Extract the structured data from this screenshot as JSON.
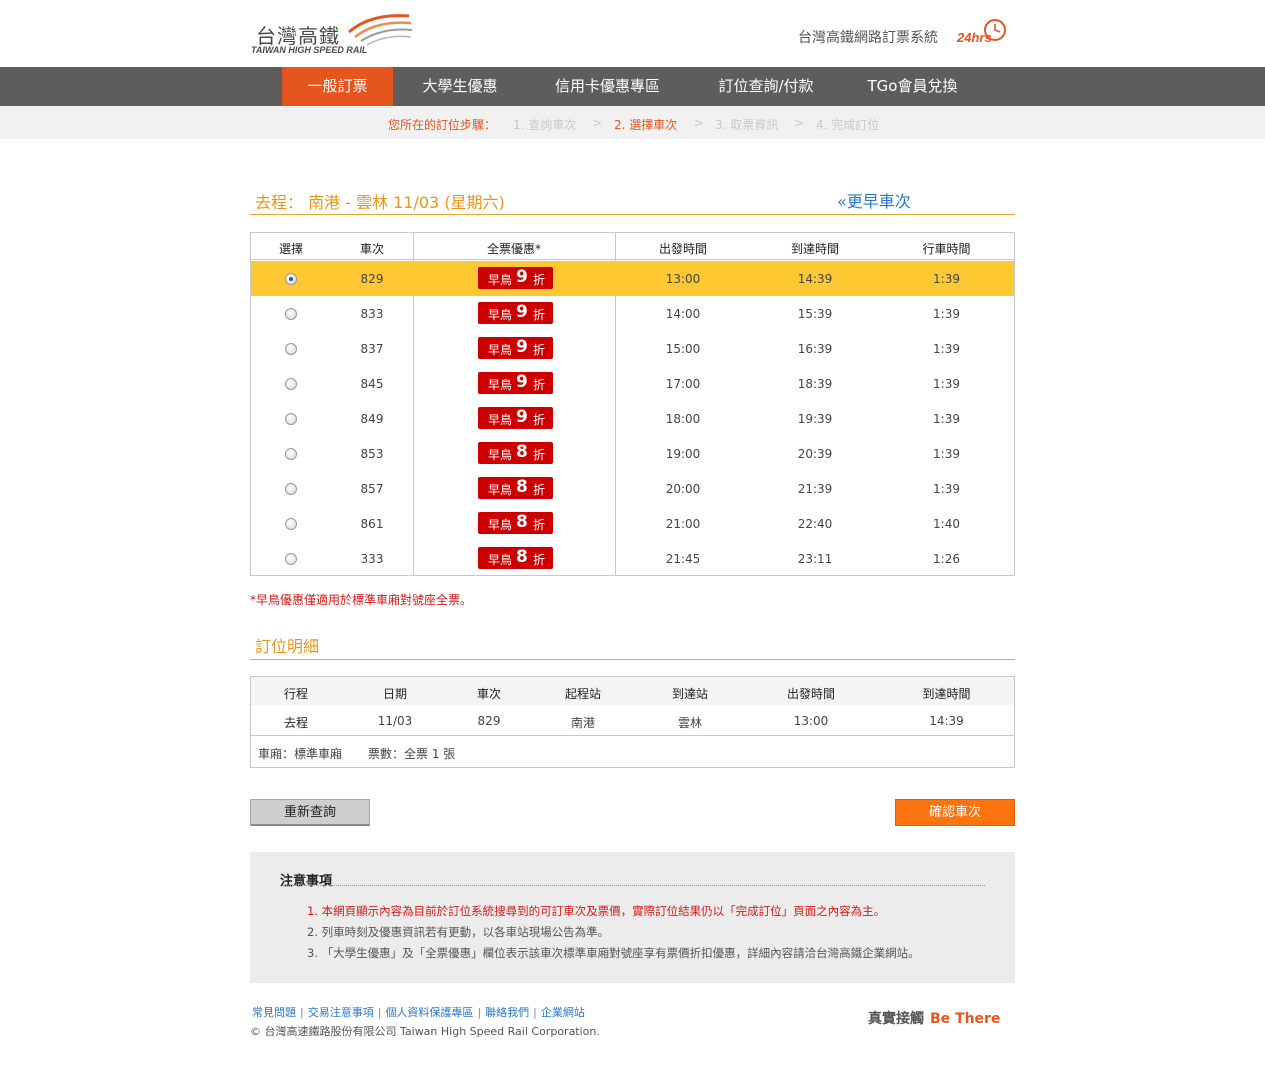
{
  "header": {
    "logo_zh": "台灣高鐵",
    "logo_en": "TAIWAN HIGH SPEED RAIL",
    "system_title": "台灣高鐵網路訂票系統",
    "system_24": "24hrs"
  },
  "nav": {
    "items": [
      {
        "label": "一般訂票",
        "active": true
      },
      {
        "label": "大學生優惠",
        "active": false
      },
      {
        "label": "信用卡優惠專區",
        "active": false
      },
      {
        "label": "訂位查詢/付款",
        "active": false
      },
      {
        "label": "TGo會員兌換",
        "active": false
      }
    ]
  },
  "steps": {
    "label": "您所在的訂位步驟：",
    "items": [
      "1. 查詢車次",
      "2. 選擇車次",
      "3. 取票資訊",
      "4. 完成訂位"
    ],
    "separator": ">",
    "current": 1
  },
  "trip": {
    "title": "去程： 南港 - 雲林 11/03 (星期六)",
    "earlier_link": "«更早車次"
  },
  "trains_table": {
    "headers": [
      "選擇",
      "車次",
      "全票優惠*",
      "出發時間",
      "到達時間",
      "行車時間"
    ],
    "rows": [
      {
        "train": "829",
        "discount_prefix": "早鳥",
        "discount": "9",
        "discount_suffix": "折",
        "depart": "13:00",
        "arrive": "14:39",
        "duration": "1:39",
        "selected": true
      },
      {
        "train": "833",
        "discount_prefix": "早鳥",
        "discount": "9",
        "discount_suffix": "折",
        "depart": "14:00",
        "arrive": "15:39",
        "duration": "1:39",
        "selected": false
      },
      {
        "train": "837",
        "discount_prefix": "早鳥",
        "discount": "9",
        "discount_suffix": "折",
        "depart": "15:00",
        "arrive": "16:39",
        "duration": "1:39",
        "selected": false
      },
      {
        "train": "845",
        "discount_prefix": "早鳥",
        "discount": "9",
        "discount_suffix": "折",
        "depart": "17:00",
        "arrive": "18:39",
        "duration": "1:39",
        "selected": false
      },
      {
        "train": "849",
        "discount_prefix": "早鳥",
        "discount": "9",
        "discount_suffix": "折",
        "depart": "18:00",
        "arrive": "19:39",
        "duration": "1:39",
        "selected": false
      },
      {
        "train": "853",
        "discount_prefix": "早鳥",
        "discount": "8",
        "discount_suffix": "折",
        "depart": "19:00",
        "arrive": "20:39",
        "duration": "1:39",
        "selected": false
      },
      {
        "train": "857",
        "discount_prefix": "早鳥",
        "discount": "8",
        "discount_suffix": "折",
        "depart": "20:00",
        "arrive": "21:39",
        "duration": "1:39",
        "selected": false
      },
      {
        "train": "861",
        "discount_prefix": "早鳥",
        "discount": "8",
        "discount_suffix": "折",
        "depart": "21:00",
        "arrive": "22:40",
        "duration": "1:40",
        "selected": false
      },
      {
        "train": "333",
        "discount_prefix": "早鳥",
        "discount": "8",
        "discount_suffix": "折",
        "depart": "21:45",
        "arrive": "23:11",
        "duration": "1:26",
        "selected": false
      }
    ],
    "footnote": "*早鳥優惠僅適用於標準車廂對號座全票。"
  },
  "booking": {
    "title": "訂位明細",
    "headers": [
      "行程",
      "日期",
      "車次",
      "起程站",
      "到達站",
      "出發時間",
      "到達時間"
    ],
    "row": [
      "去程",
      "11/03",
      "829",
      "南港",
      "雲林",
      "13:00",
      "14:39"
    ],
    "car_type": "車廂：標準車廂",
    "ticket_count": "票數：全票 1 張"
  },
  "buttons": {
    "requery": "重新查詢",
    "confirm": "確認車次"
  },
  "notice": {
    "title": "注意事項",
    "items": [
      "1. 本網頁顯示內容為目前於訂位系統搜尋到的可訂車次及票價，實際訂位結果仍以「完成訂位」頁面之內容為主。",
      "2. 列車時刻及優惠資訊若有更動，以各車站現場公告為準。",
      "3. 「大學生優惠」及「全票優惠」欄位表示該車次標準車廂對號座享有票價折扣優惠，詳細內容請洽台灣高鐵企業網站。"
    ]
  },
  "footer": {
    "links": [
      "常見問題",
      "交易注意事項",
      "個人資料保護專區",
      "聯絡我們",
      "企業網站"
    ],
    "copyright": "© 台灣高速鐵路股份有限公司 Taiwan High Speed Rail Corporation.",
    "slogan_zh": "真實接觸",
    "slogan_en": "Be There"
  },
  "colors": {
    "accent_orange": "#e5551e",
    "title_gold": "#e8971a",
    "selected_row": "#fdc832",
    "badge_red": "#cc0000",
    "nav_gray": "#5f5d5c"
  }
}
